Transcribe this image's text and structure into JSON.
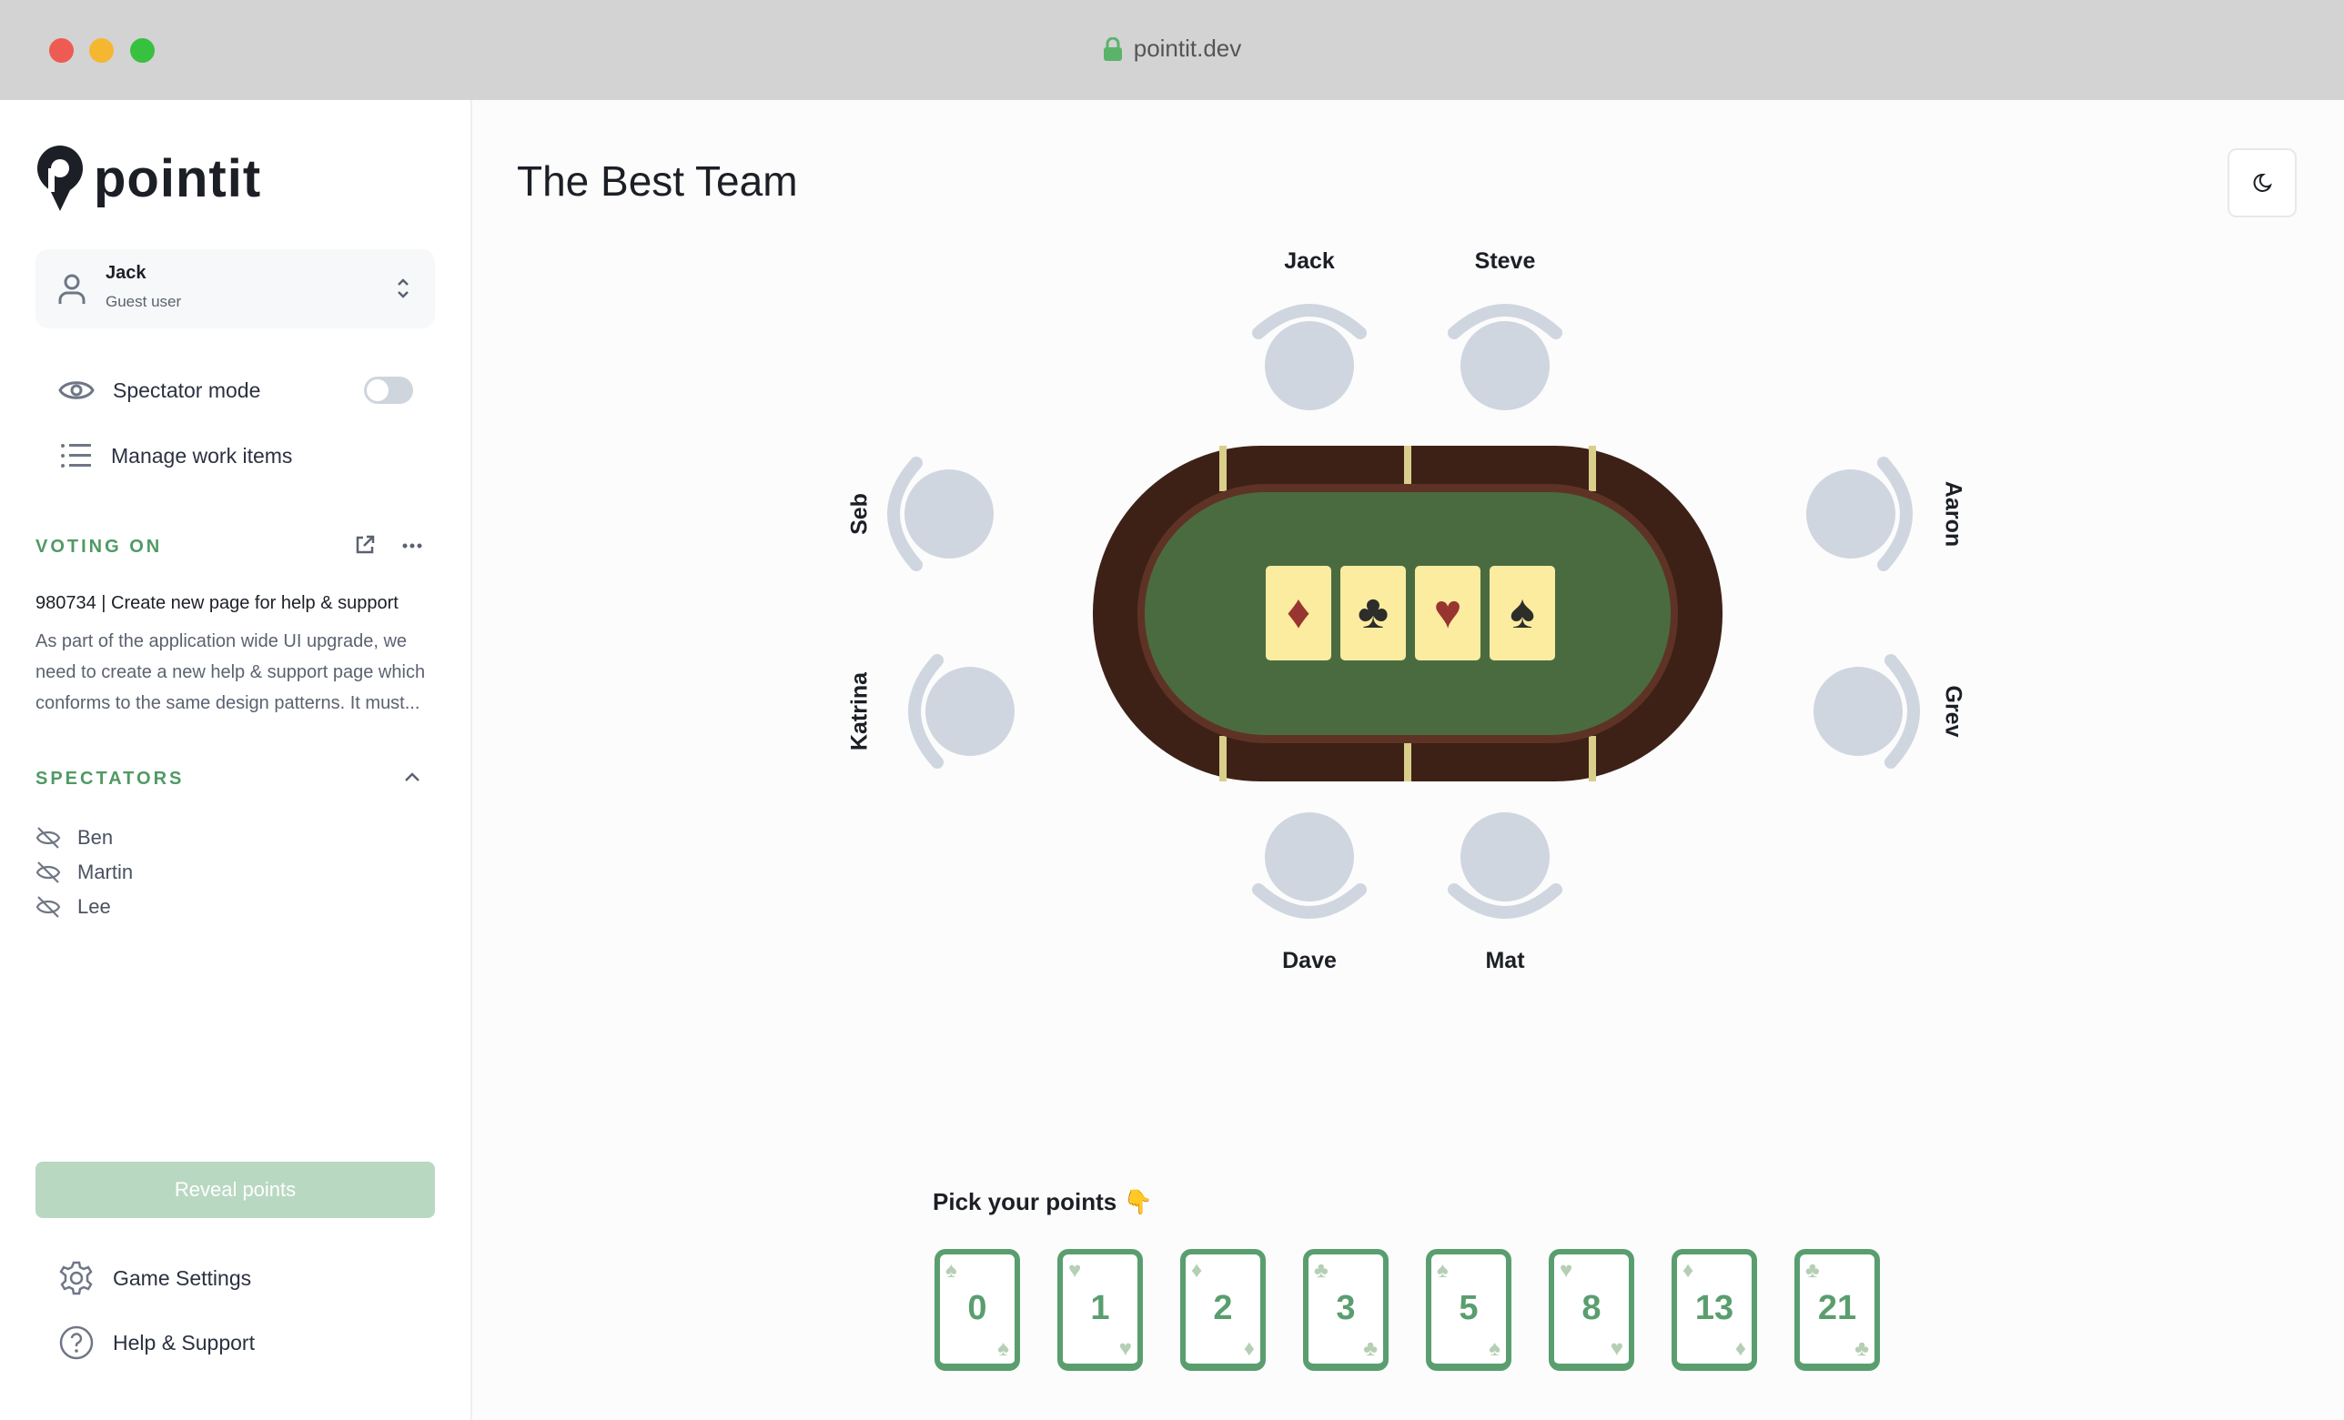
{
  "browser": {
    "url": "pointit.dev"
  },
  "sidebar": {
    "logo": "pointit",
    "user": {
      "name": "Jack",
      "role": "Guest user"
    },
    "spectator_mode": {
      "label": "Spectator mode",
      "enabled": false
    },
    "manage_label": "Manage work items",
    "voting_on": {
      "heading": "VOTING ON",
      "title": "980734 | Create new page for help & support",
      "description": "As part of the application wide UI upgrade, we need to create a new help & support page which conforms to the same design patterns. It must..."
    },
    "spectators": {
      "heading": "SPECTATORS",
      "names": [
        "Ben",
        "Martin",
        "Lee"
      ]
    },
    "reveal_label": "Reveal points",
    "settings_label": "Game Settings",
    "help_label": "Help & Support"
  },
  "main": {
    "title": "The Best Team",
    "players": {
      "top": [
        "Jack",
        "Steve"
      ],
      "bottom": [
        "Dave",
        "Mat"
      ],
      "left": [
        "Seb",
        "Katrina"
      ],
      "right": [
        "Aaron",
        "Grev"
      ]
    },
    "table_cards": [
      "♦",
      "♣",
      "♥",
      "♠"
    ],
    "pick_label": "Pick your points 👇",
    "point_cards": [
      {
        "v": "0",
        "s": "♠"
      },
      {
        "v": "1",
        "s": "♥"
      },
      {
        "v": "2",
        "s": "♦"
      },
      {
        "v": "3",
        "s": "♣"
      },
      {
        "v": "5",
        "s": "♠"
      },
      {
        "v": "8",
        "s": "♥"
      },
      {
        "v": "13",
        "s": "♦"
      },
      {
        "v": "21",
        "s": "♣"
      }
    ]
  },
  "colors": {
    "accent": "#5a9e6f",
    "felt": "#4a6b40",
    "rim": "#3d2117"
  }
}
